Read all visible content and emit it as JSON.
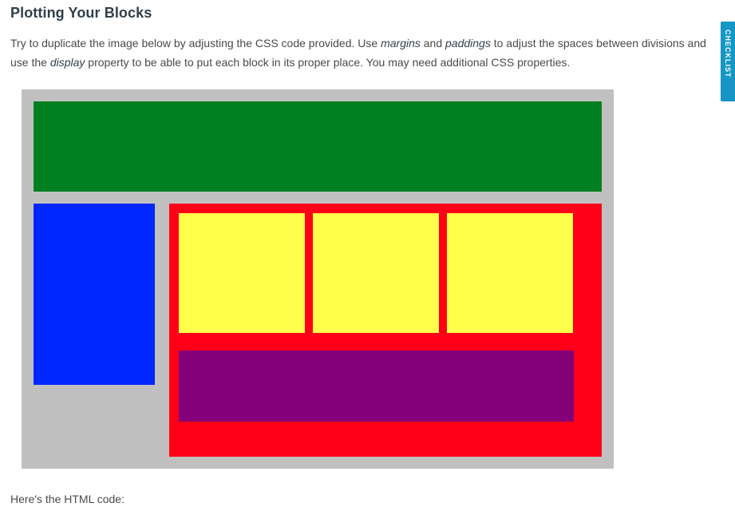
{
  "page": {
    "title": "Plotting Your Blocks"
  },
  "intro": {
    "t1": "Try to duplicate the image below by adjusting the CSS code provided. Use ",
    "em1": "margins",
    "t2": " and ",
    "em2": "paddings",
    "t3": " to adjust the spaces between divisions and use the ",
    "em3": "display",
    "t4": " property to be able to put each block in its proper place. You may need additional CSS properties."
  },
  "checklist_tab": {
    "label": "CHECKLIST"
  },
  "diagram": {
    "colors": {
      "background": "#c0c0c0",
      "header": "#008020",
      "sidebar": "#0026ff",
      "main": "#ff0018",
      "yellow": "#ffff4c",
      "purple": "#840078"
    }
  },
  "outro": {
    "text": "Here's the HTML code:"
  }
}
